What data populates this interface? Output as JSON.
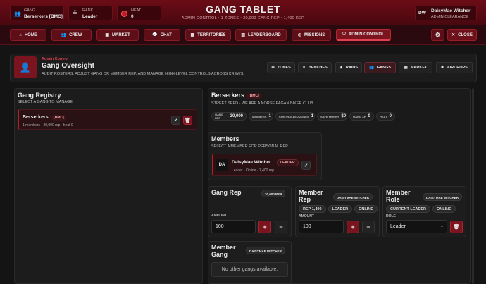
{
  "header": {
    "gang_label": "GANG",
    "gang_value": "Berserkers [BMC]",
    "rank_label": "RANK",
    "rank_value": "Leader",
    "heat_label": "HEAT",
    "heat_value": "0",
    "title": "GANG TABLET",
    "subtitle": "ADMIN CONTROL • 1 ZONES • 30,000 GANG REP • 1,400 REP",
    "user_initials": "DW",
    "user_name": "DaisyMae Witcher",
    "user_role": "ADMIN CLEARANCE"
  },
  "nav": {
    "home": "HOME",
    "crew": "CREW",
    "market": "MARKET",
    "chat": "CHAT",
    "territories": "TERRITORIES",
    "leaderboard": "LEADERBOARD",
    "missions": "MISSIONS",
    "admin_control": "ADMIN CONTROL",
    "close": "CLOSE"
  },
  "oversight": {
    "eyebrow": "Admin Control",
    "title": "Gang Oversight",
    "description": "AUDIT ROSTERS, ADJUST GANG OR MEMBER REP, AND MANAGE HIGH-LEVEL CONTROLS ACROSS CREWS.",
    "tabs": {
      "zones": "ZONES",
      "benches": "BENCHES",
      "raids": "RAIDS",
      "gangs": "GANGS",
      "market": "MARKET",
      "airdrops": "AIRDROPS"
    }
  },
  "registry": {
    "title": "Gang Registry",
    "subtitle": "SELECT A GANG TO MANAGE.",
    "item_name": "Berserkers",
    "item_tag": "[BMC]",
    "item_meta": "1 members · 30,000 rep · heat 0"
  },
  "gang_detail": {
    "name": "Berserkers",
    "tag": "[BMC]",
    "seed": "STREET SEED · WE ARE A NORSE PAGAN BIKER CLUB.",
    "stats": [
      {
        "label": "GANG REP",
        "value": "30,000"
      },
      {
        "label": "MEMBERS",
        "value": "1"
      },
      {
        "label": "CONTROLLED ZONES",
        "value": "1"
      },
      {
        "label": "SAFE MONEY",
        "value": "$0"
      },
      {
        "label": "GANG XP",
        "value": "0"
      },
      {
        "label": "HEAT",
        "value": "0"
      }
    ]
  },
  "members": {
    "title": "Members",
    "subtitle": "SELECT A MEMBER FOR PERSONAL REP.",
    "initials": "DA",
    "name": "DaisyMae Witcher",
    "badge": "LEADER",
    "meta": "Leader · Online · 1,400 rep"
  },
  "gang_rep": {
    "title": "Gang Rep",
    "badge": "30,000 REP",
    "amount_label": "AMOUNT",
    "amount_value": "100"
  },
  "member_rep": {
    "title": "Member Rep",
    "badge": "DAISYMAE WITCHER",
    "tags": [
      "REP 1,400",
      "LEADER",
      "ONLINE"
    ],
    "amount_label": "AMOUNT",
    "amount_value": "100"
  },
  "member_role": {
    "title": "Member Role",
    "badge": "DAISYMAE WITCHER",
    "tags": [
      "CURRENT LEADER",
      "ONLINE"
    ],
    "role_label": "ROLE",
    "role_value": "Leader"
  },
  "member_gang": {
    "title": "Member Gang",
    "badge": "DAISYMAE WITCHER",
    "empty_text": "No other gangs available."
  },
  "colors": {
    "accent": "#9b1420",
    "header_bg": "#5a0a12",
    "panel": "#1d1d1d",
    "page": "#141414"
  }
}
